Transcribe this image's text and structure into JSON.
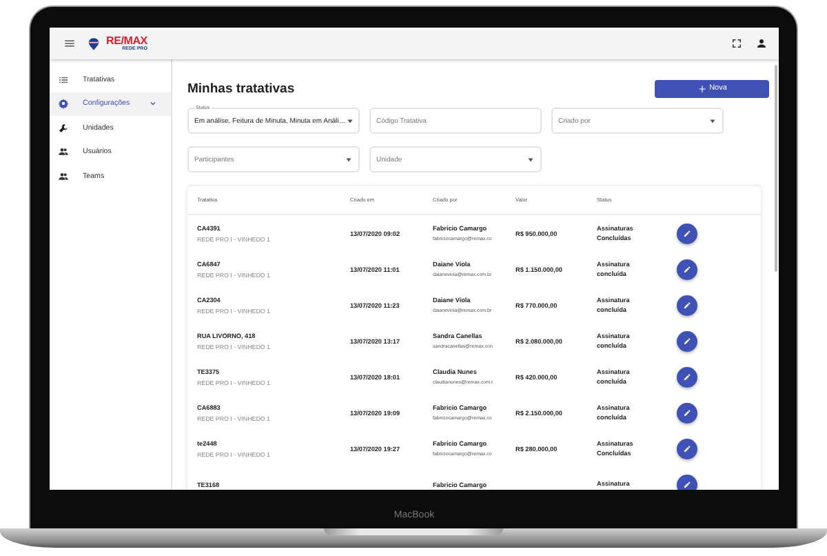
{
  "device": {
    "brand": "MacBook"
  },
  "topbar": {
    "logo": {
      "name": "RE/MAX",
      "sub": "REDE PRO"
    }
  },
  "sidebar": {
    "items": [
      {
        "label": "Tratativas",
        "kind": "list",
        "selected": false
      },
      {
        "label": "Configurações",
        "kind": "gear",
        "selected": true,
        "expanded": true
      },
      {
        "label": "Unidades",
        "kind": "wrench",
        "selected": false
      },
      {
        "label": "Usuários",
        "kind": "people",
        "selected": false
      },
      {
        "label": "Teams",
        "kind": "people",
        "selected": false
      }
    ]
  },
  "page": {
    "title": "Minhas tratativas",
    "new_button": "Nova"
  },
  "filters": [
    {
      "label": "Status",
      "value": "Em análise, Feitura de Minuta, Minuta em Análi…",
      "kind": "select"
    },
    {
      "placeholder": "Código Tratativa",
      "kind": "text"
    },
    {
      "placeholder": "Criado por",
      "kind": "select"
    },
    {
      "placeholder": "Participantes",
      "kind": "select"
    },
    {
      "placeholder": "Unidade",
      "kind": "select"
    }
  ],
  "table": {
    "columns": [
      "Tratativa",
      "Criado em",
      "Criado por",
      "Valor",
      "Status"
    ],
    "rows": [
      {
        "code": "CA4391",
        "unit": "REDE PRO I - VINHEDO 1",
        "created_at": "13/07/2020 09:02",
        "creator": "Fabricio Camargo",
        "email": "fabriciocamargo@remax.co",
        "value": "R$  950.000,00",
        "status": "Assinaturas Concluídas"
      },
      {
        "code": "CA6847",
        "unit": "REDE PRO I - VINHEDO 1",
        "created_at": "13/07/2020 11:01",
        "creator": "Daiane Viola",
        "email": "daianeviola@remax.com.br",
        "value": "R$  1.150.000,00",
        "status": "Assinatura concluída"
      },
      {
        "code": "CA2304",
        "unit": "REDE PRO I - VINHEDO 1",
        "created_at": "13/07/2020 11:23",
        "creator": "Daiane Viola",
        "email": "daianeviola@remax.com.br",
        "value": "R$  770.000,00",
        "status": "Assinatura concluída"
      },
      {
        "code": "RUA LIVORNO, 418",
        "unit": "REDE PRO I - VINHEDO 1",
        "created_at": "13/07/2020 13:17",
        "creator": "Sandra Canellas",
        "email": "sandracanellas@remax.con",
        "value": "R$  2.080.000,00",
        "status": "Assinatura concluída"
      },
      {
        "code": "TE3375",
        "unit": "REDE PRO I - VINHEDO 1",
        "created_at": "13/07/2020 18:01",
        "creator": "Claudia Nunes",
        "email": "claudianunes@remax.com.t",
        "value": "R$  420.000,00",
        "status": "Assinatura concluída"
      },
      {
        "code": "CA6883",
        "unit": "REDE PRO I - VINHEDO 1",
        "created_at": "13/07/2020 19:09",
        "creator": "Fabricio Camargo",
        "email": "fabriciocamargo@remax.co",
        "value": "R$  2.150.000,00",
        "status": "Assinatura concluída"
      },
      {
        "code": "te2448",
        "unit": "REDE PRO I - VINHEDO 1",
        "created_at": "13/07/2020 19:27",
        "creator": "Fabricio Camargo",
        "email": "fabriciocamargo@remax.co",
        "value": "R$  280.000,00",
        "status": "Assinaturas Concluídas"
      },
      {
        "code": "TE3168",
        "creator": "Fabricio Camargo",
        "status": "Assinatura"
      }
    ]
  }
}
